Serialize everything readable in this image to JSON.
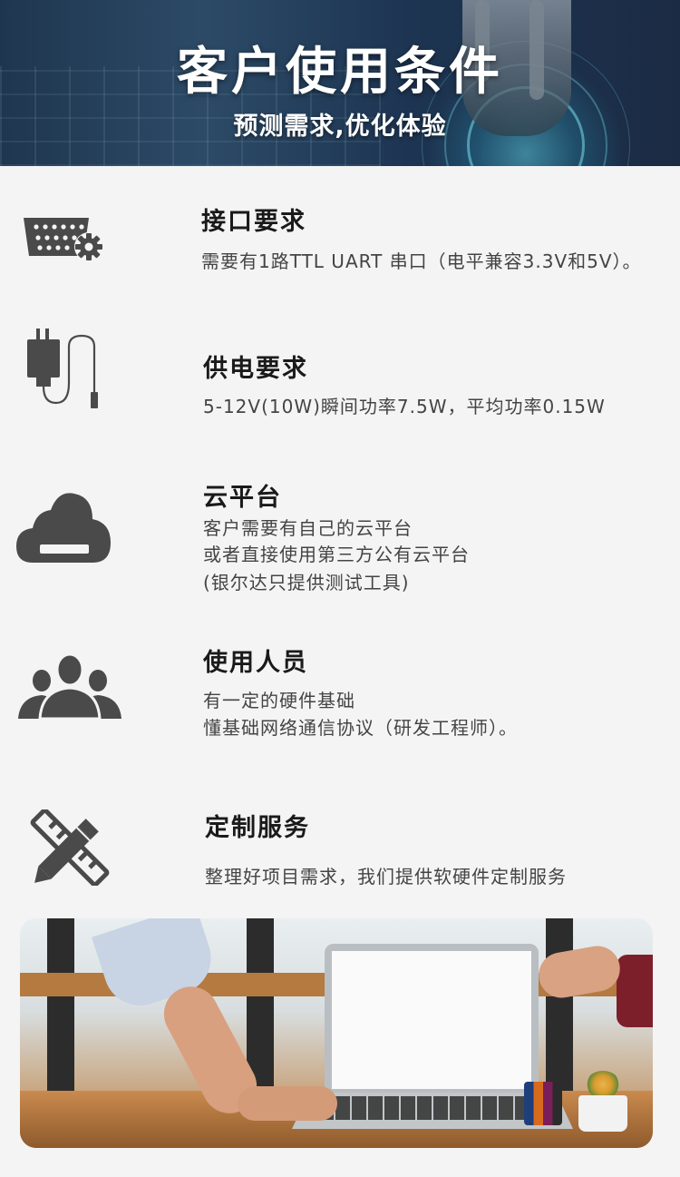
{
  "banner": {
    "title": "客户使用条件",
    "subtitle": "预测需求,优化体验"
  },
  "items": [
    {
      "icon": "serial-port-gear-icon",
      "title": "接口要求",
      "lines": [
        "需要有1路TTL UART 串口（电平兼容3.3V和5V）。"
      ]
    },
    {
      "icon": "power-adapter-icon",
      "title": "供电要求",
      "lines": [
        "5-12V(10W)瞬间功率7.5W，平均功率0.15W"
      ]
    },
    {
      "icon": "cloud-icon",
      "title": "云平台",
      "lines": [
        "客户需要有自己的云平台",
        "或者直接使用第三方公有云平台",
        "(银尔达只提供测试工具)"
      ]
    },
    {
      "icon": "users-group-icon",
      "title": "使用人员",
      "lines": [
        "有一定的硬件基础",
        "懂基础网络通信协议（研发工程师）。"
      ]
    },
    {
      "icon": "pencil-ruler-icon",
      "title": "定制服务",
      "lines": [
        "整理好项目需求，我们提供软硬件定制服务"
      ]
    }
  ],
  "colors": {
    "icon": "#4a4a4a",
    "background": "#f4f4f4",
    "title": "#1a1a1a",
    "text": "#444444"
  }
}
